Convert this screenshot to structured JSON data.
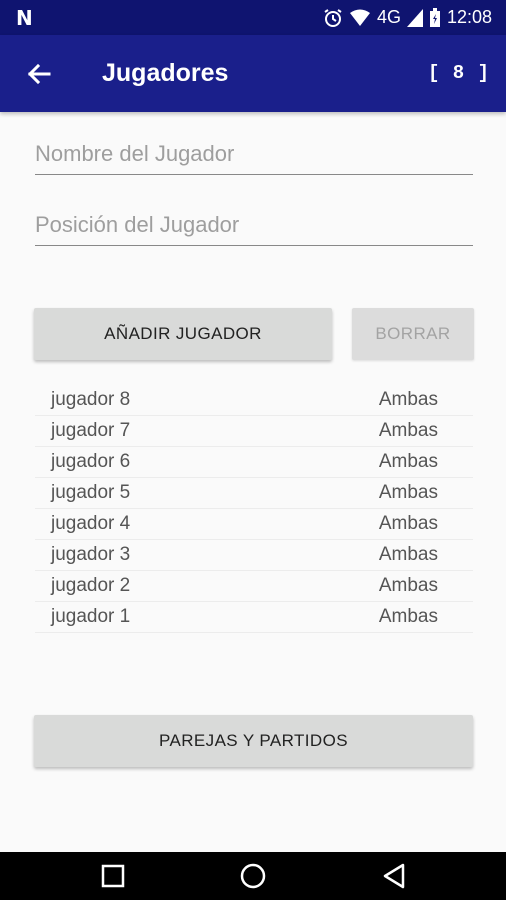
{
  "status_bar": {
    "time": "12:08",
    "network": "4G"
  },
  "app_bar": {
    "title": "Jugadores",
    "count_badge": "[ 8 ]"
  },
  "form": {
    "name_placeholder": "Nombre del Jugador",
    "name_value": "",
    "position_placeholder": "Posición del Jugador",
    "position_value": ""
  },
  "buttons": {
    "add_label": "AÑADIR JUGADOR",
    "delete_label": "BORRAR",
    "pairs_label": "PAREJAS Y PARTIDOS"
  },
  "players": [
    {
      "name": "jugador 8",
      "position": "Ambas"
    },
    {
      "name": "jugador 7",
      "position": "Ambas"
    },
    {
      "name": "jugador 6",
      "position": "Ambas"
    },
    {
      "name": "jugador 5",
      "position": "Ambas"
    },
    {
      "name": "jugador 4",
      "position": "Ambas"
    },
    {
      "name": "jugador 3",
      "position": "Ambas"
    },
    {
      "name": "jugador 2",
      "position": "Ambas"
    },
    {
      "name": "jugador 1",
      "position": "Ambas"
    }
  ],
  "colors": {
    "primary": "#1a1f8b",
    "primary_dark": "#0f1470",
    "button": "#d9dad9"
  },
  "icons": {
    "status": [
      "notification-n-icon",
      "alarm-icon",
      "wifi-icon",
      "signal-icon",
      "battery-icon"
    ],
    "nav": [
      "recent-apps-icon",
      "home-icon",
      "back-nav-icon"
    ]
  }
}
